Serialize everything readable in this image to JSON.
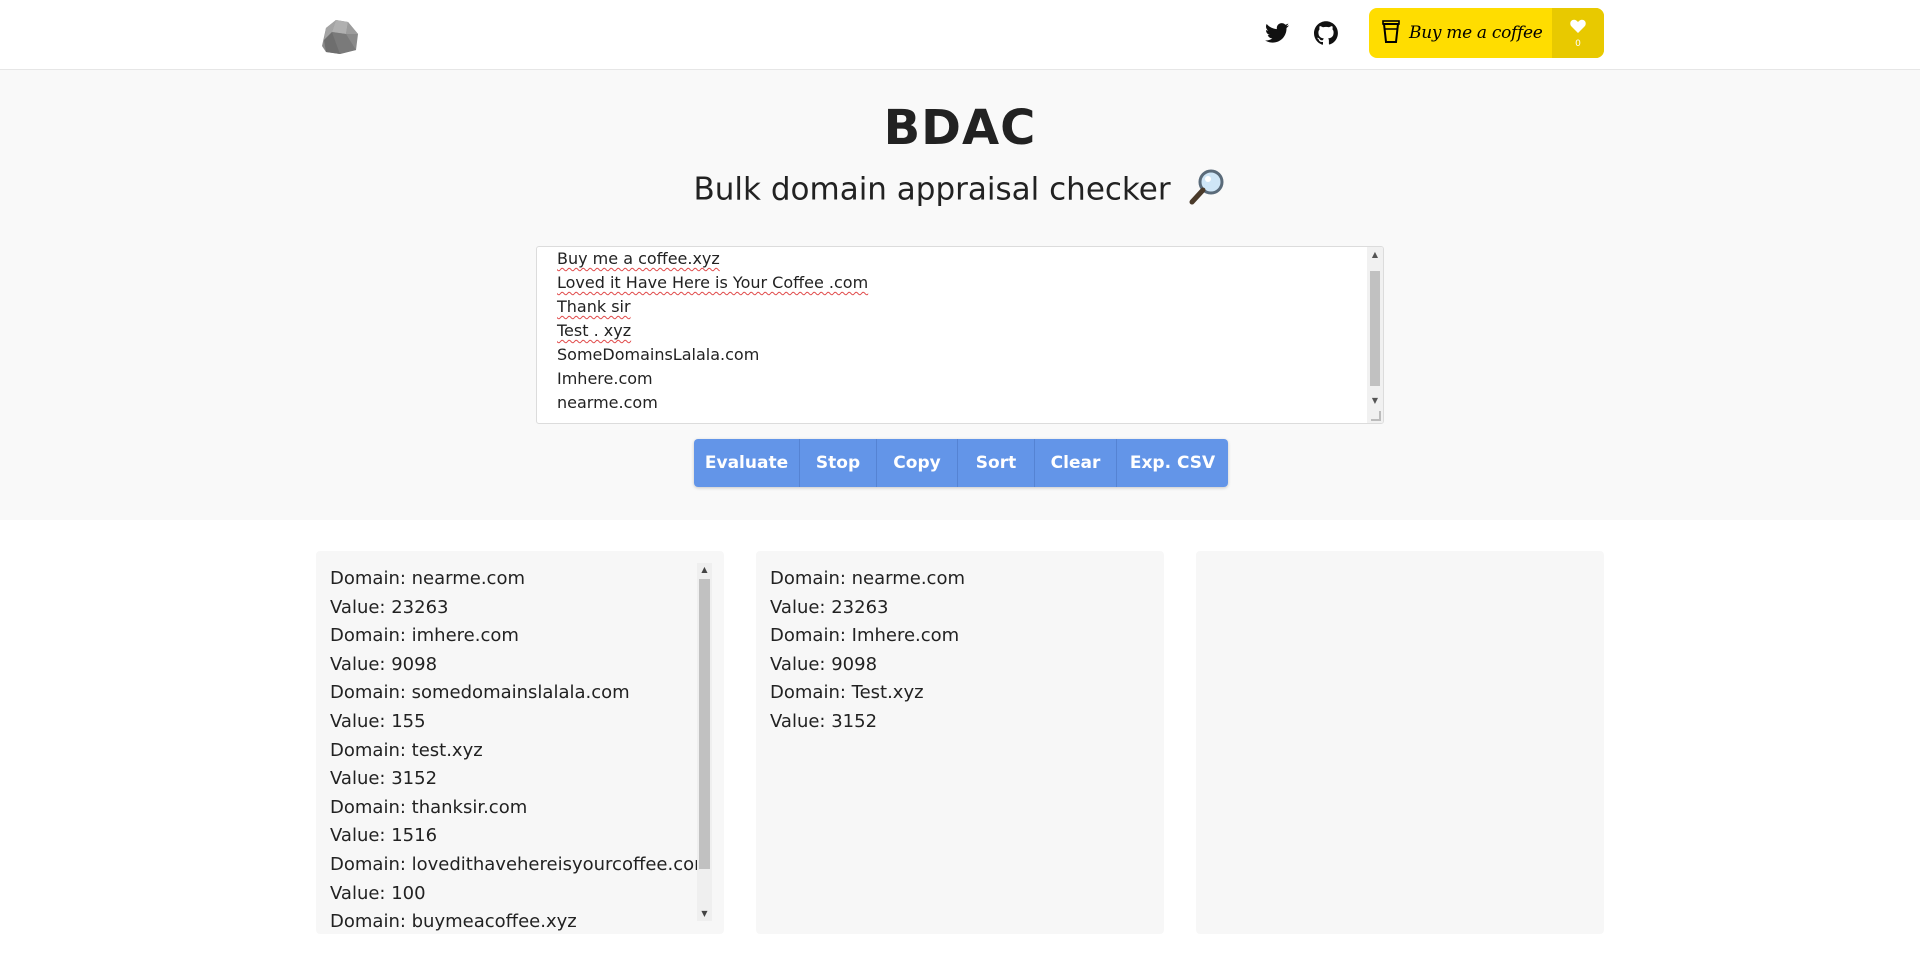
{
  "header": {
    "logo_icon": "rock-logo-icon",
    "twitter_icon": "twitter-icon",
    "github_icon": "github-icon",
    "bmc_label": "Buy me a coffee",
    "bmc_count": "0"
  },
  "hero": {
    "title": "BDAC",
    "subtitle": "Bulk domain appraisal checker"
  },
  "input": {
    "lines": [
      "Buy me a coffee.xyz",
      "Loved it Have Here is Your Coffee .com",
      "Thank sir",
      "Test . xyz",
      "SomeDomainsLalala.com",
      "Imhere.com",
      "nearme.com"
    ]
  },
  "buttons": {
    "evaluate": "Evaluate",
    "stop": "Stop",
    "copy": "Copy",
    "sort": "Sort",
    "clear": "Clear",
    "export_csv": "Exp. CSV"
  },
  "panels": {
    "left": [
      "Domain: nearme.com",
      "Value: 23263",
      "Domain: imhere.com",
      "Value: 9098",
      "Domain: somedomainslalala.com",
      "Value: 155",
      "Domain: test.xyz",
      "Value: 3152",
      "Domain: thanksir.com",
      "Value: 1516",
      "Domain: lovedithavehereisyourcoffee.com",
      "Value: 100",
      "Domain: buymeacoffee.xyz"
    ],
    "middle": [
      "Domain: nearme.com",
      "Value: 23263",
      "Domain: Imhere.com",
      "Value: 9098",
      "Domain: Test.xyz",
      "Value: 3152"
    ],
    "right": []
  },
  "colors": {
    "accent": "#6395e8",
    "bmc_yellow": "#ffdd00",
    "hero_bg": "#f9f9f9"
  }
}
